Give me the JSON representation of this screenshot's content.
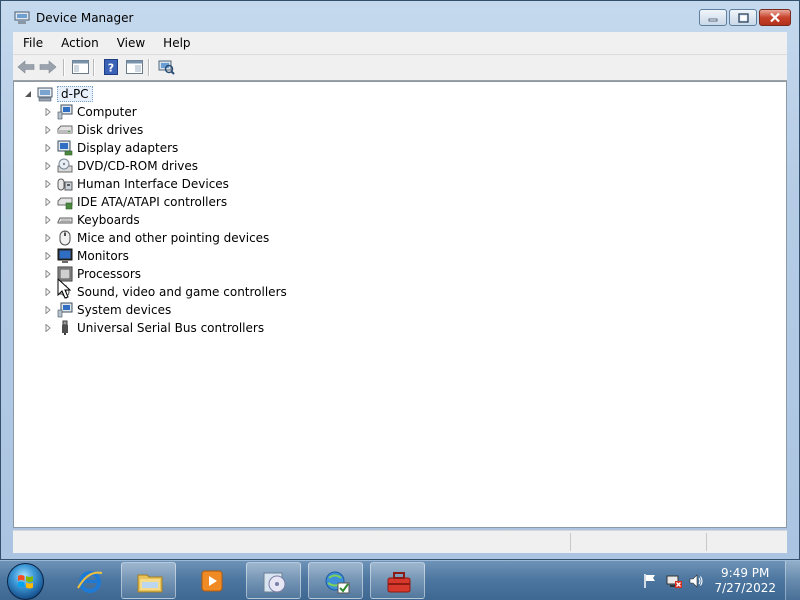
{
  "window": {
    "title": "Device Manager"
  },
  "menubar": [
    "File",
    "Action",
    "View",
    "Help"
  ],
  "toolbar": {
    "buttons": [
      "back-icon",
      "forward-icon",
      "show-hide-console-tree-icon",
      "help-icon",
      "properties-icon",
      "scan-hardware-icon"
    ]
  },
  "tree": {
    "root": "d-PC",
    "items": [
      {
        "label": "Computer",
        "icon": "computer-icon"
      },
      {
        "label": "Disk drives",
        "icon": "disk-drive-icon"
      },
      {
        "label": "Display adapters",
        "icon": "display-adapter-icon"
      },
      {
        "label": "DVD/CD-ROM drives",
        "icon": "dvd-drive-icon"
      },
      {
        "label": "Human Interface Devices",
        "icon": "hid-icon"
      },
      {
        "label": "IDE ATA/ATAPI controllers",
        "icon": "ide-controller-icon"
      },
      {
        "label": "Keyboards",
        "icon": "keyboard-icon"
      },
      {
        "label": "Mice and other pointing devices",
        "icon": "mouse-icon"
      },
      {
        "label": "Monitors",
        "icon": "monitor-icon"
      },
      {
        "label": "Processors",
        "icon": "processor-icon"
      },
      {
        "label": "Sound, video and game controllers",
        "icon": "sound-icon"
      },
      {
        "label": "System devices",
        "icon": "system-devices-icon"
      },
      {
        "label": "Universal Serial Bus controllers",
        "icon": "usb-icon"
      }
    ]
  },
  "taskbar": {
    "items": [
      "internet-explorer-icon",
      "windows-explorer-icon",
      "media-player-icon",
      "cd-burner-icon",
      "network-check-icon",
      "toolbox-icon"
    ],
    "clock": {
      "time": "9:49 PM",
      "date": "7/27/2022"
    }
  },
  "colors": {
    "title_bar": "#b7cde6",
    "taskbar": "#4d77a0",
    "close_button": "#c7432a"
  }
}
